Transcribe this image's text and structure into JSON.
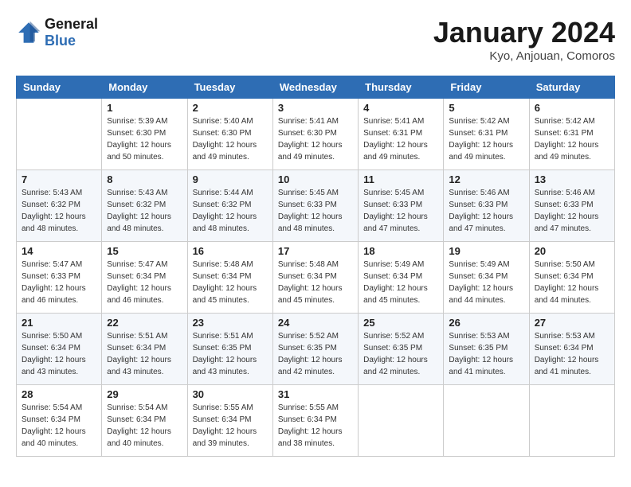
{
  "header": {
    "logo_line1": "General",
    "logo_line2": "Blue",
    "title": "January 2024",
    "subtitle": "Kyo, Anjouan, Comoros"
  },
  "days_of_week": [
    "Sunday",
    "Monday",
    "Tuesday",
    "Wednesday",
    "Thursday",
    "Friday",
    "Saturday"
  ],
  "weeks": [
    [
      {
        "day": "",
        "info": ""
      },
      {
        "day": "1",
        "info": "Sunrise: 5:39 AM\nSunset: 6:30 PM\nDaylight: 12 hours\nand 50 minutes."
      },
      {
        "day": "2",
        "info": "Sunrise: 5:40 AM\nSunset: 6:30 PM\nDaylight: 12 hours\nand 49 minutes."
      },
      {
        "day": "3",
        "info": "Sunrise: 5:41 AM\nSunset: 6:30 PM\nDaylight: 12 hours\nand 49 minutes."
      },
      {
        "day": "4",
        "info": "Sunrise: 5:41 AM\nSunset: 6:31 PM\nDaylight: 12 hours\nand 49 minutes."
      },
      {
        "day": "5",
        "info": "Sunrise: 5:42 AM\nSunset: 6:31 PM\nDaylight: 12 hours\nand 49 minutes."
      },
      {
        "day": "6",
        "info": "Sunrise: 5:42 AM\nSunset: 6:31 PM\nDaylight: 12 hours\nand 49 minutes."
      }
    ],
    [
      {
        "day": "7",
        "info": "Sunrise: 5:43 AM\nSunset: 6:32 PM\nDaylight: 12 hours\nand 48 minutes."
      },
      {
        "day": "8",
        "info": "Sunrise: 5:43 AM\nSunset: 6:32 PM\nDaylight: 12 hours\nand 48 minutes."
      },
      {
        "day": "9",
        "info": "Sunrise: 5:44 AM\nSunset: 6:32 PM\nDaylight: 12 hours\nand 48 minutes."
      },
      {
        "day": "10",
        "info": "Sunrise: 5:45 AM\nSunset: 6:33 PM\nDaylight: 12 hours\nand 48 minutes."
      },
      {
        "day": "11",
        "info": "Sunrise: 5:45 AM\nSunset: 6:33 PM\nDaylight: 12 hours\nand 47 minutes."
      },
      {
        "day": "12",
        "info": "Sunrise: 5:46 AM\nSunset: 6:33 PM\nDaylight: 12 hours\nand 47 minutes."
      },
      {
        "day": "13",
        "info": "Sunrise: 5:46 AM\nSunset: 6:33 PM\nDaylight: 12 hours\nand 47 minutes."
      }
    ],
    [
      {
        "day": "14",
        "info": "Sunrise: 5:47 AM\nSunset: 6:33 PM\nDaylight: 12 hours\nand 46 minutes."
      },
      {
        "day": "15",
        "info": "Sunrise: 5:47 AM\nSunset: 6:34 PM\nDaylight: 12 hours\nand 46 minutes."
      },
      {
        "day": "16",
        "info": "Sunrise: 5:48 AM\nSunset: 6:34 PM\nDaylight: 12 hours\nand 45 minutes."
      },
      {
        "day": "17",
        "info": "Sunrise: 5:48 AM\nSunset: 6:34 PM\nDaylight: 12 hours\nand 45 minutes."
      },
      {
        "day": "18",
        "info": "Sunrise: 5:49 AM\nSunset: 6:34 PM\nDaylight: 12 hours\nand 45 minutes."
      },
      {
        "day": "19",
        "info": "Sunrise: 5:49 AM\nSunset: 6:34 PM\nDaylight: 12 hours\nand 44 minutes."
      },
      {
        "day": "20",
        "info": "Sunrise: 5:50 AM\nSunset: 6:34 PM\nDaylight: 12 hours\nand 44 minutes."
      }
    ],
    [
      {
        "day": "21",
        "info": "Sunrise: 5:50 AM\nSunset: 6:34 PM\nDaylight: 12 hours\nand 43 minutes."
      },
      {
        "day": "22",
        "info": "Sunrise: 5:51 AM\nSunset: 6:34 PM\nDaylight: 12 hours\nand 43 minutes."
      },
      {
        "day": "23",
        "info": "Sunrise: 5:51 AM\nSunset: 6:35 PM\nDaylight: 12 hours\nand 43 minutes."
      },
      {
        "day": "24",
        "info": "Sunrise: 5:52 AM\nSunset: 6:35 PM\nDaylight: 12 hours\nand 42 minutes."
      },
      {
        "day": "25",
        "info": "Sunrise: 5:52 AM\nSunset: 6:35 PM\nDaylight: 12 hours\nand 42 minutes."
      },
      {
        "day": "26",
        "info": "Sunrise: 5:53 AM\nSunset: 6:35 PM\nDaylight: 12 hours\nand 41 minutes."
      },
      {
        "day": "27",
        "info": "Sunrise: 5:53 AM\nSunset: 6:34 PM\nDaylight: 12 hours\nand 41 minutes."
      }
    ],
    [
      {
        "day": "28",
        "info": "Sunrise: 5:54 AM\nSunset: 6:34 PM\nDaylight: 12 hours\nand 40 minutes."
      },
      {
        "day": "29",
        "info": "Sunrise: 5:54 AM\nSunset: 6:34 PM\nDaylight: 12 hours\nand 40 minutes."
      },
      {
        "day": "30",
        "info": "Sunrise: 5:55 AM\nSunset: 6:34 PM\nDaylight: 12 hours\nand 39 minutes."
      },
      {
        "day": "31",
        "info": "Sunrise: 5:55 AM\nSunset: 6:34 PM\nDaylight: 12 hours\nand 38 minutes."
      },
      {
        "day": "",
        "info": ""
      },
      {
        "day": "",
        "info": ""
      },
      {
        "day": "",
        "info": ""
      }
    ]
  ]
}
